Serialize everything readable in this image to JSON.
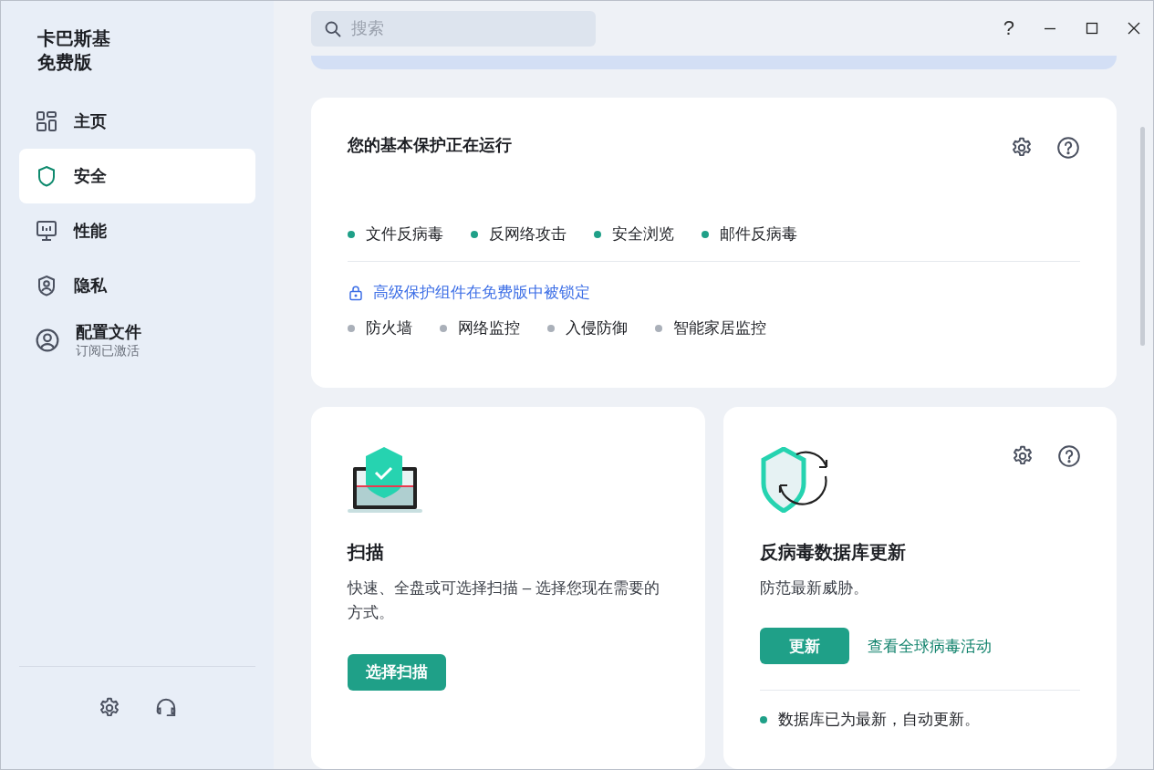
{
  "app": {
    "title_lines": [
      "卡巴斯基",
      "免费版"
    ]
  },
  "sidebar": {
    "items": [
      {
        "label": "主页",
        "selected": false
      },
      {
        "label": "安全",
        "selected": true
      },
      {
        "label": "性能",
        "selected": false
      },
      {
        "label": "隐私",
        "selected": false
      },
      {
        "label": "配置文件",
        "sublabel": "订阅已激活",
        "selected": false
      }
    ]
  },
  "search": {
    "placeholder": "搜索"
  },
  "window_controls": {
    "help": "?"
  },
  "protection_card": {
    "title": "您的基本保护正在运行",
    "components": [
      {
        "label": "文件反病毒",
        "active": true
      },
      {
        "label": "反网络攻击",
        "active": true
      },
      {
        "label": "安全浏览",
        "active": true
      },
      {
        "label": "邮件反病毒",
        "active": true
      }
    ],
    "locked_link": "高级保护组件在免费版中被锁定",
    "locked_components": [
      {
        "label": "防火墙",
        "active": false
      },
      {
        "label": "网络监控",
        "active": false
      },
      {
        "label": "入侵防御",
        "active": false
      },
      {
        "label": "智能家居监控",
        "active": false
      }
    ]
  },
  "scan_card": {
    "title": "扫描",
    "description": "快速、全盘或可选择扫描 – 选择您现在需要的方式。",
    "button": "选择扫描"
  },
  "update_card": {
    "title": "反病毒数据库更新",
    "description": "防范最新威胁。",
    "button": "更新",
    "link": "查看全球病毒活动",
    "status": "数据库已为最新，自动更新。",
    "status_ok": true
  }
}
